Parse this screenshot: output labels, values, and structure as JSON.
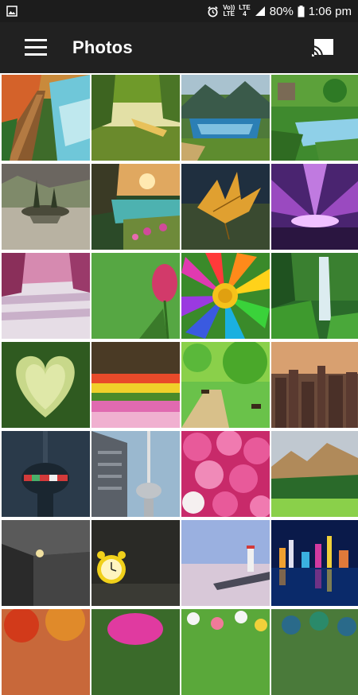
{
  "status_bar": {
    "left_icon": "image-notification-icon",
    "network_label_top": "Vo))",
    "network_label_bottom": "LTE",
    "signal_label_top": "LTE",
    "signal_label_bottom": "4",
    "battery_percent": "80%",
    "time": "1:06 pm"
  },
  "app_bar": {
    "title": "Photos",
    "menu_icon": "hamburger-menu-icon",
    "cast_icon": "cast-icon"
  },
  "photos": [
    {
      "name": "forest-boardwalk-waterfall-photo"
    },
    {
      "name": "lake-canoe-reflection-photo"
    },
    {
      "name": "mountain-lake-village-photo"
    },
    {
      "name": "forest-stream-cabin-photo"
    },
    {
      "name": "stormy-island-reflection-photo"
    },
    {
      "name": "sunset-river-flowers-photo"
    },
    {
      "name": "autumn-leaf-closeup-photo"
    },
    {
      "name": "purple-aurora-rays-photo"
    },
    {
      "name": "pink-waterfall-forest-photo"
    },
    {
      "name": "pink-tulip-green-photo"
    },
    {
      "name": "rainbow-daisy-flower-photo"
    },
    {
      "name": "jungle-waterfall-photo"
    },
    {
      "name": "heart-shaped-hedge-photo"
    },
    {
      "name": "tulip-field-rows-photo"
    },
    {
      "name": "green-park-path-photo"
    },
    {
      "name": "city-skyline-sunset-photo"
    },
    {
      "name": "cn-tower-night-photo"
    },
    {
      "name": "cn-tower-buildings-photo"
    },
    {
      "name": "pink-roses-photo"
    },
    {
      "name": "mountain-pine-forest-photo"
    },
    {
      "name": "dark-lamp-corner-photo"
    },
    {
      "name": "yellow-alarm-clock-photo"
    },
    {
      "name": "lighthouse-sunset-pier-photo"
    },
    {
      "name": "city-night-reflection-photo"
    },
    {
      "name": "autumn-trees-photo"
    },
    {
      "name": "magenta-flower-photo"
    },
    {
      "name": "daisy-meadow-photo"
    },
    {
      "name": "peacock-feathers-photo"
    }
  ]
}
